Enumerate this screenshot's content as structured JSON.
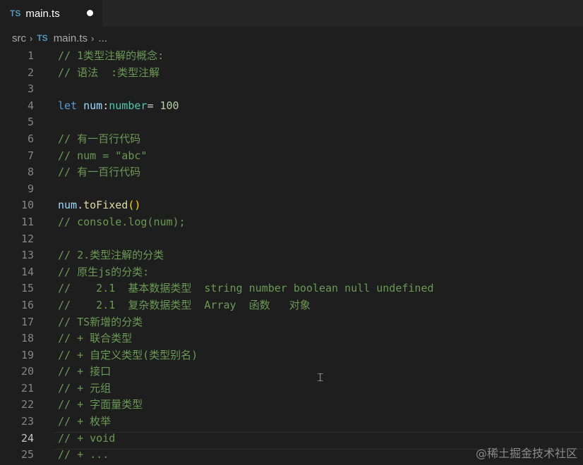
{
  "tab": {
    "icon": "TS",
    "name": "main.ts"
  },
  "breadcrumb": {
    "folder": "src",
    "sep": "›",
    "icon": "TS",
    "file": "main.ts",
    "more": "..."
  },
  "lines": [
    {
      "n": "1",
      "tokens": [
        {
          "t": "// 1类型注解的概念:",
          "c": "cmt"
        }
      ]
    },
    {
      "n": "2",
      "tokens": [
        {
          "t": "// 语法  :类型注解",
          "c": "cmt"
        }
      ]
    },
    {
      "n": "3",
      "tokens": []
    },
    {
      "n": "4",
      "tokens": [
        {
          "t": "let",
          "c": "kw"
        },
        {
          "t": " "
        },
        {
          "t": "num",
          "c": "var"
        },
        {
          "t": ":"
        },
        {
          "t": "number",
          "c": "type"
        },
        {
          "t": "= "
        },
        {
          "t": "100",
          "c": "num"
        }
      ]
    },
    {
      "n": "5",
      "tokens": []
    },
    {
      "n": "6",
      "tokens": [
        {
          "t": "// 有一百行代码",
          "c": "cmt"
        }
      ]
    },
    {
      "n": "7",
      "tokens": [
        {
          "t": "// num = \"abc\"",
          "c": "cmt"
        }
      ]
    },
    {
      "n": "8",
      "tokens": [
        {
          "t": "// 有一百行代码",
          "c": "cmt"
        }
      ]
    },
    {
      "n": "9",
      "tokens": []
    },
    {
      "n": "10",
      "tokens": [
        {
          "t": "num",
          "c": "var"
        },
        {
          "t": "."
        },
        {
          "t": "toFixed",
          "c": "fn"
        },
        {
          "t": "()",
          "c": "paren"
        }
      ]
    },
    {
      "n": "11",
      "tokens": [
        {
          "t": "// console.log(num);",
          "c": "cmt"
        }
      ]
    },
    {
      "n": "12",
      "tokens": []
    },
    {
      "n": "13",
      "tokens": [
        {
          "t": "// 2.类型注解的分类",
          "c": "cmt"
        }
      ]
    },
    {
      "n": "14",
      "tokens": [
        {
          "t": "// 原生js的分类:",
          "c": "cmt"
        }
      ]
    },
    {
      "n": "15",
      "tokens": [
        {
          "t": "//    2.1  基本数据类型  string number boolean null undefined",
          "c": "cmt"
        }
      ]
    },
    {
      "n": "16",
      "tokens": [
        {
          "t": "//    2.1  复杂数据类型  Array  函数   对象",
          "c": "cmt"
        }
      ]
    },
    {
      "n": "17",
      "tokens": [
        {
          "t": "// TS新增的分类",
          "c": "cmt"
        }
      ]
    },
    {
      "n": "18",
      "tokens": [
        {
          "t": "// + 联合类型",
          "c": "cmt"
        }
      ]
    },
    {
      "n": "19",
      "tokens": [
        {
          "t": "// + 自定义类型(类型别名)",
          "c": "cmt"
        }
      ]
    },
    {
      "n": "20",
      "tokens": [
        {
          "t": "// + 接口",
          "c": "cmt"
        }
      ]
    },
    {
      "n": "21",
      "tokens": [
        {
          "t": "// + 元组",
          "c": "cmt"
        }
      ]
    },
    {
      "n": "22",
      "tokens": [
        {
          "t": "// + 字面量类型",
          "c": "cmt"
        }
      ]
    },
    {
      "n": "23",
      "tokens": [
        {
          "t": "// + 枚举",
          "c": "cmt"
        }
      ]
    },
    {
      "n": "24",
      "tokens": [
        {
          "t": "// + void",
          "c": "cmt"
        }
      ],
      "active": true
    },
    {
      "n": "25",
      "tokens": [
        {
          "t": "// + ...",
          "c": "cmt"
        }
      ]
    }
  ],
  "watermark": "@稀土掘金技术社区",
  "colors": {
    "background": "#1e1e1e",
    "comment": "#6a9955",
    "keyword": "#569cd6",
    "variable": "#9cdcfe",
    "type": "#4ec9b0",
    "number": "#b5cea8",
    "function": "#dcdcaa"
  }
}
